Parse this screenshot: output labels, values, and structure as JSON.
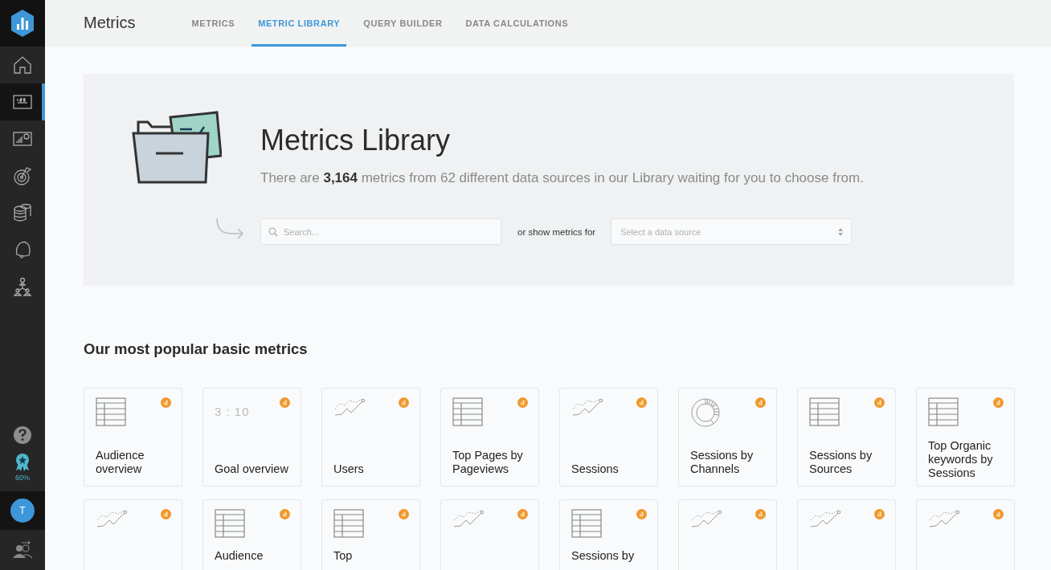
{
  "sidebar": {
    "items": [
      {
        "kind": "home",
        "selected": false
      },
      {
        "kind": "numbers",
        "selected": true
      },
      {
        "kind": "dashboard",
        "selected": false
      },
      {
        "kind": "goal",
        "selected": false
      },
      {
        "kind": "database",
        "selected": false
      },
      {
        "kind": "bell",
        "selected": false
      },
      {
        "kind": "team",
        "selected": false
      }
    ],
    "bottom": {
      "progress": "60%",
      "avatar": "T"
    }
  },
  "header": {
    "title": "Metrics",
    "tabs": [
      {
        "label": "METRICS",
        "selected": false
      },
      {
        "label": "METRIC LIBRARY",
        "selected": true
      },
      {
        "label": "QUERY BUILDER",
        "selected": false
      },
      {
        "label": "DATA CALCULATIONS",
        "selected": false
      }
    ]
  },
  "hero": {
    "title": "Metrics Library",
    "sentence": "There are **3,164** metrics from 62 different data sources in our Library waiting for you to choose from.",
    "search": {
      "placeholder": "Search..."
    },
    "or_label": "or show metrics for",
    "source_select": {
      "placeholder": "Select a data source"
    }
  },
  "section": {
    "title": "Our most popular basic metrics",
    "cards": [
      {
        "kind": "table",
        "label": "Audience overview"
      },
      {
        "kind": "number",
        "preview": "3 : 10",
        "label": "Goal overview"
      },
      {
        "kind": "line",
        "label": "Users"
      },
      {
        "kind": "table",
        "label": "Top Pages by Pageviews"
      },
      {
        "kind": "line",
        "label": "Sessions"
      },
      {
        "kind": "donut",
        "label": "Sessions by Channels"
      },
      {
        "kind": "table",
        "label": "Sessions by Sources"
      },
      {
        "kind": "table",
        "label": "Top Organic keywords by Sessions"
      },
      {
        "kind": "line"
      },
      {
        "kind": "table",
        "label": "Audience"
      },
      {
        "kind": "table",
        "label": "Top"
      },
      {
        "kind": "line"
      },
      {
        "kind": "table",
        "label": "Sessions by"
      },
      {
        "kind": "line"
      },
      {
        "kind": "line"
      },
      {
        "kind": "line"
      }
    ]
  }
}
